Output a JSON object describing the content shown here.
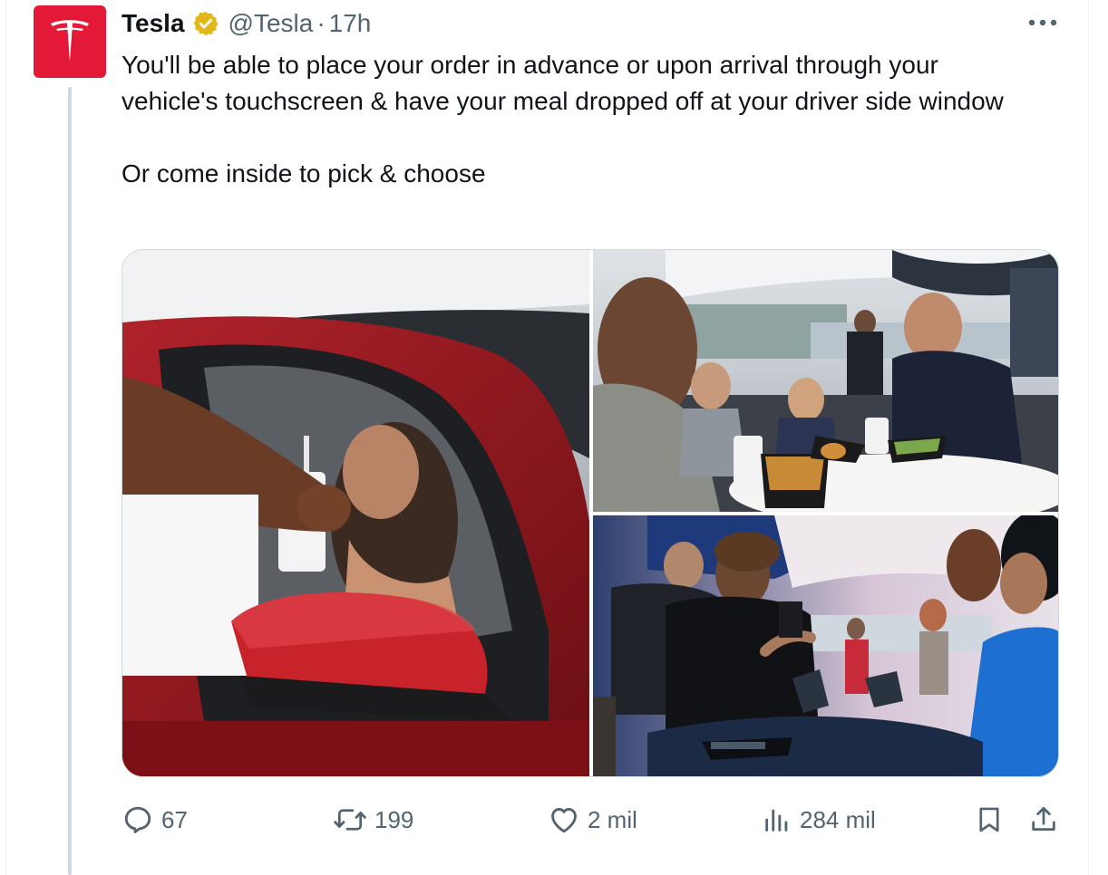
{
  "tweet": {
    "author_name": "Tesla",
    "handle": "@Tesla",
    "separator": "·",
    "time": "17h",
    "paragraph_1": "You'll be able to place your order in advance or upon arrival through your vehicle's touchscreen & have your meal dropped off at your driver side window",
    "paragraph_2": "Or come inside to pick & choose",
    "verified_badge_color": "#e2b719",
    "avatar_color": "#e31937"
  },
  "media": {
    "images": [
      {
        "icon": "photo-drive-thru-handoff"
      },
      {
        "icon": "photo-family-dining"
      },
      {
        "icon": "photo-counter-ordering"
      }
    ]
  },
  "actions": {
    "replies": "67",
    "reposts": "199",
    "likes": "2 mil",
    "views": "284 mil"
  },
  "icons": {
    "more": "more-icon",
    "reply": "reply-icon",
    "repost": "repost-icon",
    "like": "heart-icon",
    "views": "views-icon",
    "bookmark": "bookmark-icon",
    "share": "share-icon"
  }
}
